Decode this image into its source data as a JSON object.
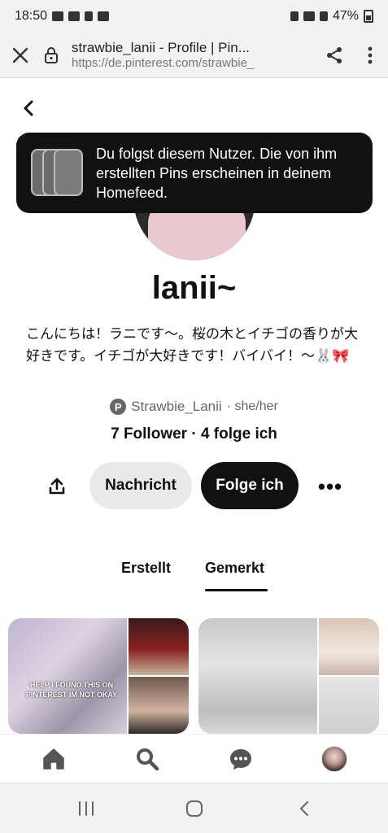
{
  "status_bar": {
    "time": "18:50",
    "battery": "47%"
  },
  "browser": {
    "title": "strawbie_lanii - Profile | Pin...",
    "url": "https://de.pinterest.com/strawbie_"
  },
  "toast": {
    "message": "Du folgst diesem Nutzer. Die von ihm erstellten Pins erscheinen in deinem Homefeed."
  },
  "profile": {
    "name": "lanii~",
    "bio": "こんにちは！ラニです〜。桜の木とイチゴの香りが大好きです。イチゴが大好きです！バイバイ！〜🐰🎀",
    "handle": "Strawbie_Lanii",
    "pronouns": "· she/her",
    "stats": "7 Follower · 4 folge ich"
  },
  "actions": {
    "message_label": "Nachricht",
    "follow_label": "Folge ich",
    "more_label": "•••"
  },
  "tabs": [
    {
      "label": "Erstellt"
    },
    {
      "label": "Gemerkt"
    }
  ],
  "boards": {
    "b1_caption": "HELP I FOUND THIS ON PINTEREST IM NOT OKAY"
  },
  "icons": {
    "close": "close-icon",
    "lock": "lock-icon",
    "share": "share-icon",
    "more": "more-vertical-icon",
    "back": "chevron-left-icon",
    "home": "home-icon",
    "search": "search-icon",
    "chat": "chat-icon"
  }
}
